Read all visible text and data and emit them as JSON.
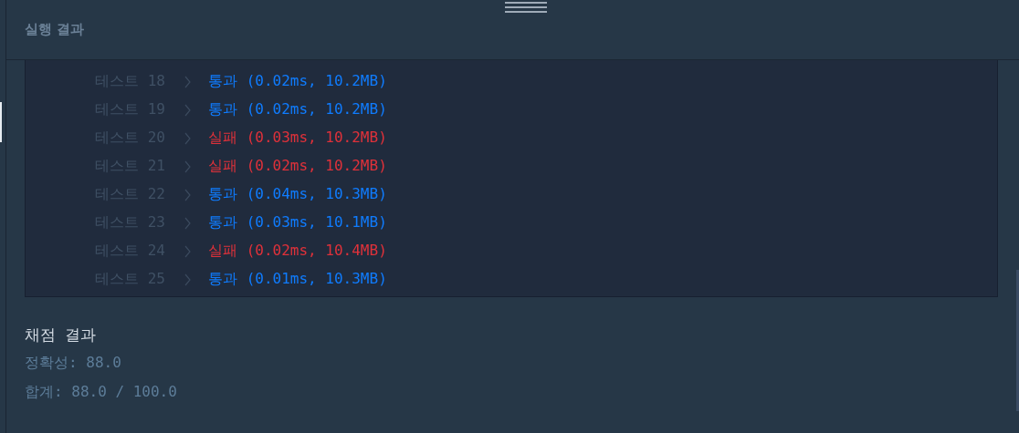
{
  "header": {
    "title": "실행 결과"
  },
  "results": [
    {
      "label": "테스트 18",
      "passed": true,
      "status": "통과",
      "detail": "(0.02ms, 10.2MB)"
    },
    {
      "label": "테스트 19",
      "passed": true,
      "status": "통과",
      "detail": "(0.02ms, 10.2MB)"
    },
    {
      "label": "테스트 20",
      "passed": false,
      "status": "실패",
      "detail": "(0.03ms, 10.2MB)"
    },
    {
      "label": "테스트 21",
      "passed": false,
      "status": "실패",
      "detail": "(0.02ms, 10.2MB)"
    },
    {
      "label": "테스트 22",
      "passed": true,
      "status": "통과",
      "detail": "(0.04ms, 10.3MB)"
    },
    {
      "label": "테스트 23",
      "passed": true,
      "status": "통과",
      "detail": "(0.03ms, 10.1MB)"
    },
    {
      "label": "테스트 24",
      "passed": false,
      "status": "실패",
      "detail": "(0.02ms, 10.4MB)"
    },
    {
      "label": "테스트 25",
      "passed": true,
      "status": "통과",
      "detail": "(0.01ms, 10.3MB)"
    }
  ],
  "score": {
    "title": "채점 결과",
    "accuracy": "정확성: 88.0",
    "total": "합계: 88.0 / 100.0"
  }
}
